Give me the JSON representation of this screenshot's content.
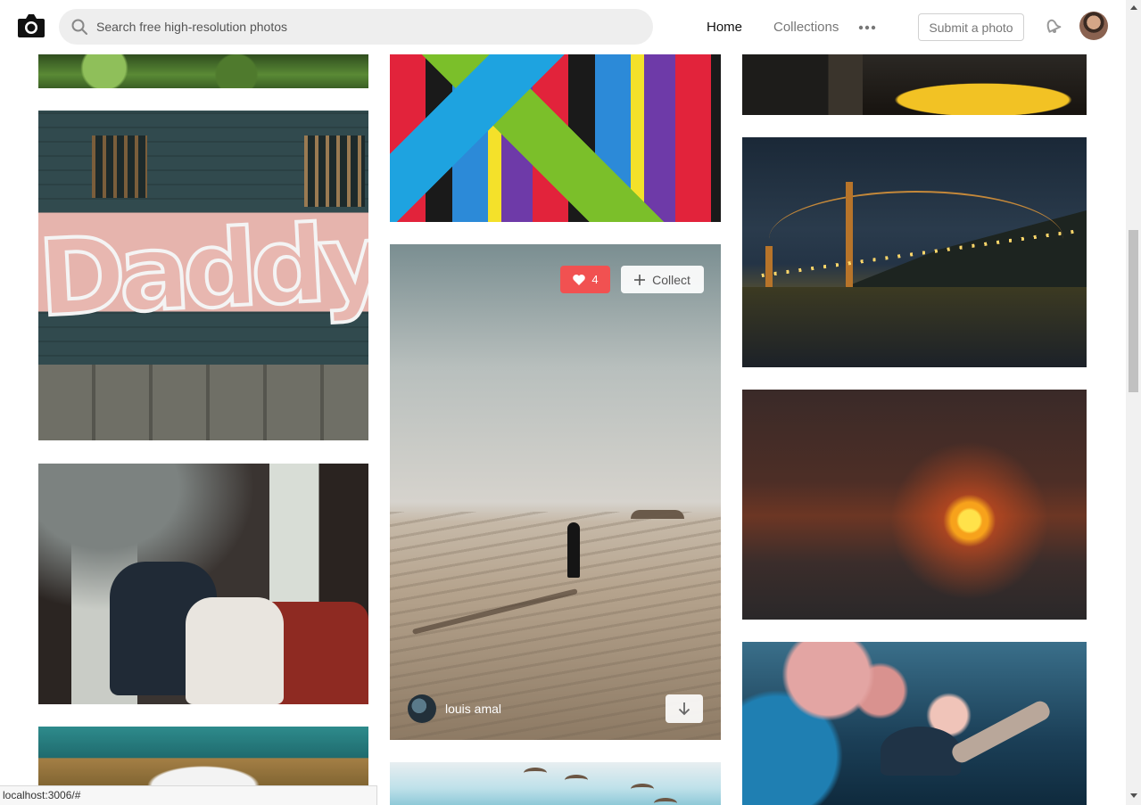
{
  "header": {
    "search_placeholder": "Search free high-resolution photos",
    "nav": {
      "home": "Home",
      "collections": "Collections"
    },
    "submit_label": "Submit a photo",
    "icons": [
      "camera-logo-icon",
      "search-icon",
      "more-dots-icon",
      "bell-icon",
      "avatar"
    ]
  },
  "photos": {
    "featured": {
      "likes": "4",
      "collect_label": "Collect",
      "author": "louis amal",
      "like_color": "#f15151"
    }
  },
  "status_bar": {
    "url": "localhost:3006/#"
  }
}
